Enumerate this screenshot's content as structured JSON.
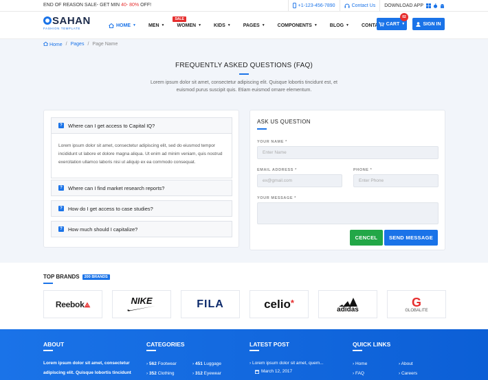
{
  "topbar": {
    "promo_prefix": "END OF REASON SALE- GET MIN",
    "promo_highlight": "40- 80%",
    "promo_suffix": "OFF!",
    "phone": "+1-123-456-7890",
    "contact": "Contact Us",
    "download": "DOWNLOAD APP"
  },
  "logo": {
    "name": "SAHAN",
    "tagline": "FASHION TEMPLATE"
  },
  "nav": {
    "items": [
      {
        "label": "HOME"
      },
      {
        "label": "MEN"
      },
      {
        "label": "WOMEN",
        "badge": "SALE"
      },
      {
        "label": "KIDS"
      },
      {
        "label": "PAGES"
      },
      {
        "label": "COMPONENTS"
      },
      {
        "label": "BLOG"
      },
      {
        "label": "CONTACT"
      }
    ],
    "cart_label": "CART",
    "cart_count": "02",
    "signin_label": "SIGN IN"
  },
  "breadcrumb": [
    "Home",
    "Pages",
    "Page Name"
  ],
  "page": {
    "title": "FREQUENTLY ASKED QUESTIONS (FAQ)",
    "subtitle": "Lorem ipsum dolor sit amet, consectetur adipiscing elit. Quisque lobortis tincidunt est, et euismod purus suscipit quis. Etiam euismod ornare elementum."
  },
  "faq": [
    {
      "q": "Where can I get access to Capital IQ?",
      "a": "Lorem ipsum dolor sit amet, consectetur adipiscing elit, sed do eiusmod tempor incididunt ut labore et dolore magna aliqua. Ut enim ad minim veniam, quis nostrud exercitation ullamco laboris nisi ut aliquip ex ea commodo consequat."
    },
    {
      "q": "Where can I find market research reports?"
    },
    {
      "q": "How do I get access to case studies?"
    },
    {
      "q": "How much should I capitalize?"
    }
  ],
  "ask": {
    "title": "ASK US QUESTION",
    "name_label": "YOUR NAME *",
    "name_placeholder": "Enter Name",
    "email_label": "EMAIL ADDRESS *",
    "email_placeholder": "ex@gmail.com",
    "phone_label": "PHONE *",
    "phone_placeholder": "Enter Phone",
    "message_label": "YOUR MESSAGE *",
    "cancel_label": "CENCEL",
    "send_label": "SEND MESSAGE"
  },
  "brands": {
    "title": "TOP BRANDS",
    "badge": "200 BRANDS",
    "items": [
      "Reebok",
      "NIKE",
      "FILA",
      "celio",
      "adidas",
      "GLOBALITE"
    ]
  },
  "footer": {
    "about_title": "ABOUT",
    "about_text_1": "Lorem ipsum dolor sit amet, consectetur",
    "about_text_2": "adipiscing elit. Quisque lobortis tincidunt",
    "categories_title": "CATEGORIES",
    "categories": [
      {
        "count": "562",
        "name": "Footwear"
      },
      {
        "count": "451",
        "name": "Luggage"
      },
      {
        "count": "352",
        "name": "Clothing"
      },
      {
        "count": "312",
        "name": "Eyewear"
      }
    ],
    "latest_title": "LATEST POST",
    "latest_post": "Lorem ipsum dolor sit amet, quem...",
    "latest_date": "March 12, 2017",
    "links_title": "QUICK LINKS",
    "links": [
      "Home",
      "About",
      "FAQ",
      "Careers"
    ]
  },
  "colors": {
    "accent": "#1a73e8",
    "sale": "#e62e2e",
    "success": "#22a747"
  }
}
